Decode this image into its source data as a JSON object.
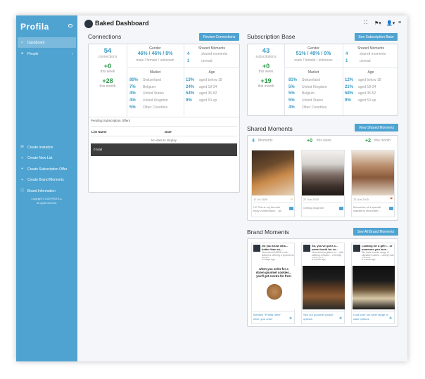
{
  "app": {
    "brand": "Profila",
    "title": "Baked Dashboard"
  },
  "sidebar": {
    "nav": [
      {
        "label": "Dashboard",
        "icon": "home-icon"
      },
      {
        "label": "People",
        "icon": "person-icon"
      }
    ],
    "actions": [
      {
        "label": "Create Invitation",
        "icon": "envelope-icon"
      },
      {
        "label": "Create New List",
        "icon": "plus-icon"
      },
      {
        "label": "Create Subscription Offer",
        "icon": "plus-icon"
      },
      {
        "label": "Create Brand Moments",
        "icon": "plus-icon"
      },
      {
        "label": "Brand Information",
        "icon": "info-icon"
      }
    ],
    "copyright": "Copyright © 2020 PROFILA.",
    "rights": "All rights reserved."
  },
  "connections": {
    "title": "Connections",
    "button": "Review Connections",
    "count": "54",
    "count_label": "connections",
    "week": "+0",
    "week_label": "this week",
    "month": "+28",
    "month_label": "this month",
    "gender_header": "Gender",
    "gender_values": "46% / 46% / 8%",
    "gender_labels": "male / female / unknown",
    "shared_header": "Shared Moments",
    "shared": [
      {
        "v": "4",
        "l": "shared moments"
      },
      {
        "v": "1",
        "l": "unread"
      }
    ],
    "market_header": "Market",
    "market": [
      {
        "v": "80%",
        "l": "Switzerland"
      },
      {
        "v": "7%",
        "l": "Belgium"
      },
      {
        "v": "4%",
        "l": "United States"
      },
      {
        "v": "4%",
        "l": "United Kingdom"
      },
      {
        "v": "5%",
        "l": "Other Countries"
      }
    ],
    "age_header": "Age",
    "age": [
      {
        "v": "13%",
        "l": "aged below 18"
      },
      {
        "v": "24%",
        "l": "aged 18-34"
      },
      {
        "v": "54%",
        "l": "aged 35-52"
      },
      {
        "v": "9%",
        "l": "aged 53-up"
      }
    ],
    "pending_title": "Pending Subscription Offers",
    "col_name": "List Name",
    "col_date": "Date",
    "no_data": "No data to display",
    "total": "0 total"
  },
  "subscription": {
    "title": "Subscription Base",
    "button": "See Subscription Base",
    "count": "43",
    "count_label": "subscriptions",
    "week": "+0",
    "week_label": "this week",
    "month": "+19",
    "month_label": "this month",
    "gender_header": "Gender",
    "gender_values": "51% / 49% / 0%",
    "gender_labels": "male / female / unknown",
    "shared_header": "Shared Moments",
    "shared": [
      {
        "v": "4",
        "l": "shared moments"
      },
      {
        "v": "1",
        "l": "unread"
      }
    ],
    "market_header": "Market",
    "market": [
      {
        "v": "81%",
        "l": "Switzerland"
      },
      {
        "v": "5%",
        "l": "United Kingdom"
      },
      {
        "v": "5%",
        "l": "Belgium"
      },
      {
        "v": "5%",
        "l": "United States"
      },
      {
        "v": "4%",
        "l": "Other Countries"
      }
    ],
    "age_header": "Age",
    "age": [
      {
        "v": "12%",
        "l": "aged below 18"
      },
      {
        "v": "21%",
        "l": "aged 18-34"
      },
      {
        "v": "58%",
        "l": "aged 35-52"
      },
      {
        "v": "9%",
        "l": "aged 53-up"
      }
    ]
  },
  "shared_moments": {
    "title": "Shared Moments",
    "button": "View Shared Moments",
    "moments": "4",
    "moments_label": "Moments",
    "week": "+0",
    "week_label": "this week",
    "month": "+2",
    "month_label": "this month",
    "cards": [
      {
        "date": "11 Jul 2020",
        "text": "Hi! This is my favorite easy combination... go all..."
      },
      {
        "date": "27 Jun 2020",
        "text": "Getting inspired!"
      },
      {
        "date": "22 Jun 2020",
        "text": "Memories of a special raspberry shortcake..."
      }
    ]
  },
  "brand_moments": {
    "title": "Brand Moments",
    "button": "See All Brand Moments",
    "cards": [
      {
        "headline": "Do you know wha... better than co...",
        "body": "How about MORE cook... Baked is offering a special for Profila...",
        "time": "14 days ago",
        "image_text": "when you order for a dozen gourmet cookies... you'll get 4 extra for free!",
        "link": "Mention \"Profila Offer\" when you order"
      },
      {
        "headline": "So, you've got a s... sweet tooth for co...",
        "body": "How about a gluten no... with walking creation... a freshly baked or a...",
        "time": "a month ago",
        "link": "See our gourmet cookie options"
      },
      {
        "headline": "Looking for a gift f... or someone you love...",
        "body": "We have a wide range of signature cakes... variety that appeals...",
        "time": "a month ago",
        "link": "Look over our wide range of cake options"
      }
    ]
  }
}
